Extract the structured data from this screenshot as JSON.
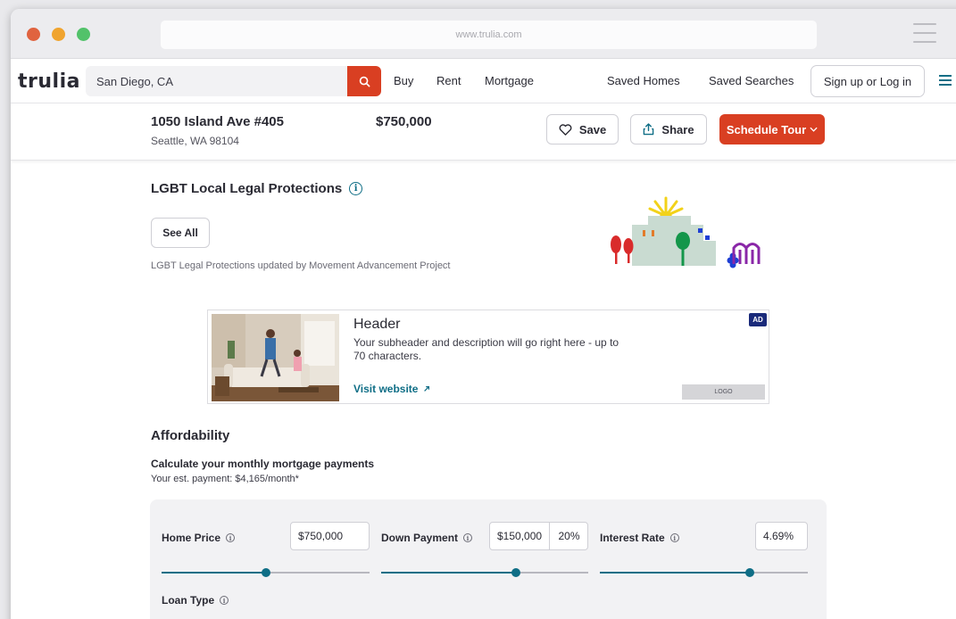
{
  "browser": {
    "url": "www.trulia.com"
  },
  "header": {
    "logo": "trulia",
    "search_value": "San Diego, CA",
    "nav": [
      "Buy",
      "Rent",
      "Mortgage",
      "Saved Homes",
      "Saved Searches"
    ],
    "login_label": "Sign up or Log in"
  },
  "listing": {
    "address_line1": "1050 Island Ave #405",
    "address_line2": "Seattle, WA 98104",
    "price": "$750,000",
    "save_label": "Save",
    "share_label": "Share",
    "tour_label": "Schedule Tour"
  },
  "lgbt": {
    "title": "LGBT Local Legal Protections",
    "see_all_label": "See All",
    "note": "LGBT Legal Protections updated by Movement Advancement Project"
  },
  "ad": {
    "header": "Header",
    "subheader": "Your subheader and description will go right here - up to 70 characters.",
    "link_label": "Visit website",
    "badge": "AD",
    "logo_label": "LOGO"
  },
  "affordability": {
    "title": "Affordability",
    "subtitle": "Calculate your monthly mortgage payments",
    "estimate": "Your est. payment: $4,165/month*",
    "home_price_label": "Home Price",
    "home_price_value": "$750,000",
    "down_payment_label": "Down Payment",
    "down_payment_value": "$150,000",
    "down_payment_pct": "20%",
    "interest_rate_label": "Interest Rate",
    "interest_rate_value": "4.69%",
    "loan_type_label": "Loan Type",
    "home_price_slider": 0.5,
    "down_payment_slider": 0.65,
    "interest_rate_slider": 0.72
  },
  "colors": {
    "brand_red": "#d93f22",
    "accent_teal": "#0f6e86",
    "text": "#2a2a33"
  }
}
